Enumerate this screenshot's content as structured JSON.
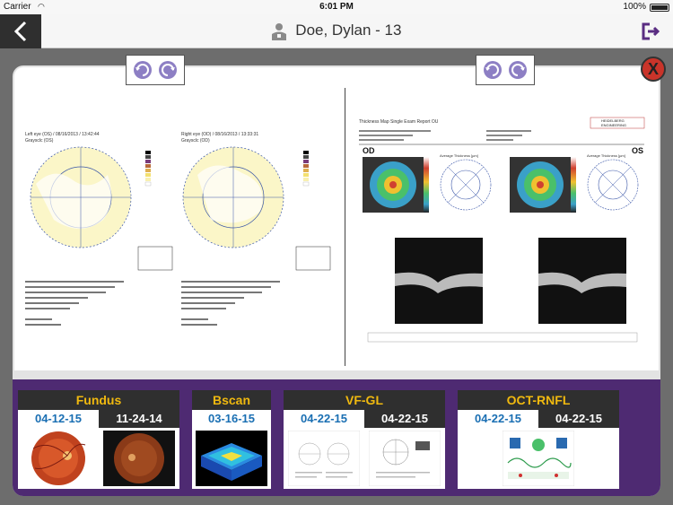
{
  "status": {
    "carrier": "Carrier",
    "time": "6:01 PM",
    "battery": "100%"
  },
  "nav": {
    "title": "Doe, Dylan - 13"
  },
  "viewer": {
    "left_doc": {
      "left_eye_title": "Left eye (OS) / 08/16/2013 / 13:42:44",
      "left_eye_sub": "Graysclc (OS)",
      "right_eye_title": "Right eye (OD) / 08/16/2013 / 13:33:31",
      "right_eye_sub": "Graysclc (OD)"
    },
    "right_doc": {
      "report_title": "Thickness Map Single Exam Report OU",
      "brand_line1": "HEIDELBERG",
      "brand_line2": "ENGINEERING",
      "od": "OD",
      "os": "OS",
      "avg_label": "Average Thickness [µm]"
    }
  },
  "close_label": "X",
  "groups": [
    {
      "title": "Fundus",
      "dates": [
        "04-12-15",
        "11-24-14"
      ]
    },
    {
      "title": "Bscan",
      "dates": [
        "03-16-15"
      ]
    },
    {
      "title": "VF-GL",
      "dates": [
        "04-22-15",
        "04-22-15"
      ]
    },
    {
      "title": "OCT-RNFL",
      "dates": [
        "04-22-15",
        "04-22-15"
      ]
    }
  ],
  "colors": {
    "accent_date": "#1a6fb3",
    "group_title": "#f0b90f",
    "thumb_bar": "#4e2a72",
    "close": "#c9342a"
  },
  "icons": {
    "back": "chevron-left-icon",
    "user": "user-badge-icon",
    "logout": "logout-icon",
    "rotate": "rotate-icon",
    "close": "close-icon"
  }
}
